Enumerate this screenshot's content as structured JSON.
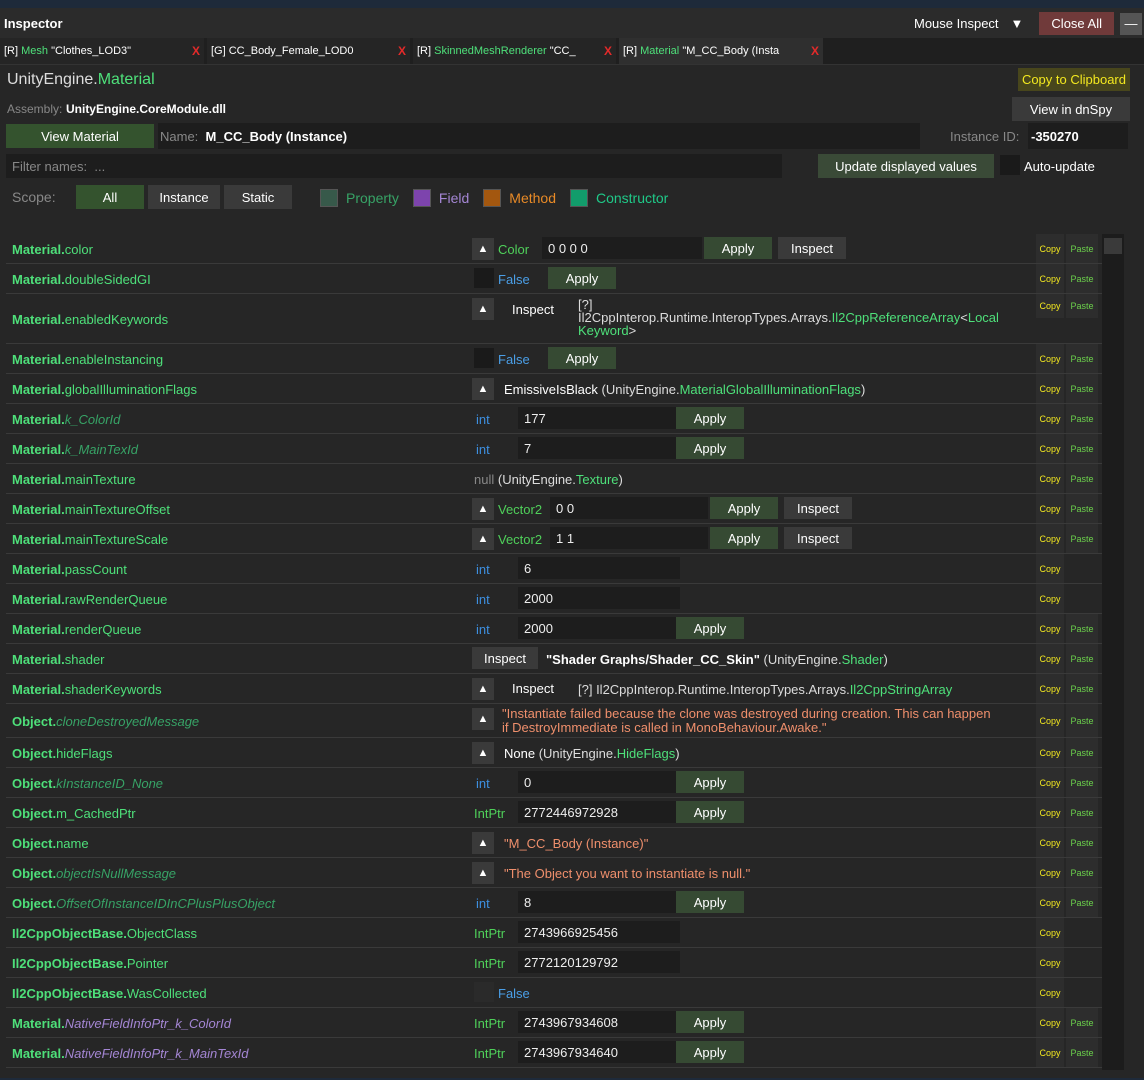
{
  "window": {
    "title": "Inspector",
    "mouse_inspect": "Mouse Inspect",
    "dropdown_glyph": "▼",
    "close_all": "Close All",
    "minimize_glyph": "—"
  },
  "tabs": [
    {
      "prefix": "[R]",
      "kind": "Mesh",
      "name": "\"Clothes_LOD3\"",
      "close": "X"
    },
    {
      "prefix": "[G]",
      "kind": "",
      "name": "CC_Body_Female_LOD0",
      "close": "X"
    },
    {
      "prefix": "[R]",
      "kind": "SkinnedMeshRenderer",
      "name": "\"CC_",
      "close": "X"
    },
    {
      "prefix": "[R]",
      "kind": "Material",
      "name": "\"M_CC_Body (Insta",
      "close": "X"
    }
  ],
  "type_header": {
    "namespace": "UnityEngine.",
    "type": "Material",
    "copy": "Copy to Clipboard"
  },
  "assembly": {
    "label": "Assembly:",
    "value": "UnityEngine.CoreModule.dll",
    "dnspy": "View in dnSpy"
  },
  "material_row": {
    "view_button": "View Material",
    "name_label": "Name:",
    "name_value": "M_CC_Body (Instance)",
    "id_label": "Instance ID:",
    "id_value": "-350270"
  },
  "filter": {
    "label": "Filter names:",
    "placeholder": "...",
    "update_button": "Update displayed values",
    "auto_update": "Auto-update"
  },
  "scope": {
    "label": "Scope:",
    "all": "All",
    "instance": "Instance",
    "static": "Static",
    "legend": {
      "property": "Property",
      "field": "Field",
      "method": "Method",
      "constructor": "Constructor"
    },
    "colors": {
      "property": "#37594a",
      "field": "#7d44ad",
      "method": "#a3570f",
      "constructor": "#129c6b"
    }
  },
  "common": {
    "apply": "Apply",
    "inspect": "Inspect",
    "copy": "Copy",
    "paste": "Paste",
    "up": "▲",
    "int": "int",
    "intptr": "IntPtr"
  },
  "members": [
    {
      "decl": "Material.",
      "member": "color",
      "type_label": "Color",
      "value": "0 0 0 0"
    },
    {
      "decl": "Material.",
      "member": "doubleSidedGI",
      "value": "False"
    },
    {
      "decl": "Material.",
      "member": "enabledKeywords",
      "v1": "[?]",
      "v2": "Il2CppInterop.Runtime.InteropTypes.Arrays.",
      "v3": "Il2CppReferenceArray",
      "v4": "<",
      "v5": "Local",
      "v6": "Keyword",
      "v7": ">"
    },
    {
      "decl": "Material.",
      "member": "enableInstancing",
      "value": "False"
    },
    {
      "decl": "Material.",
      "member": "globalIlluminationFlags",
      "v1": "EmissiveIsBlack",
      "v2": " (UnityEngine.",
      "v3": "MaterialGlobalIlluminationFlags",
      "v4": ")"
    },
    {
      "decl": "Material.",
      "member": "k_ColorId",
      "value": "177"
    },
    {
      "decl": "Material.",
      "member": "k_MainTexId",
      "value": "7"
    },
    {
      "decl": "Material.",
      "member": "mainTexture",
      "v1": "null",
      "v2": " (UnityEngine.",
      "v3": "Texture",
      "v4": ")"
    },
    {
      "decl": "Material.",
      "member": "mainTextureOffset",
      "type_label": "Vector2",
      "value": "0 0"
    },
    {
      "decl": "Material.",
      "member": "mainTextureScale",
      "type_label": "Vector2",
      "value": "1 1"
    },
    {
      "decl": "Material.",
      "member": "passCount",
      "value": "6"
    },
    {
      "decl": "Material.",
      "member": "rawRenderQueue",
      "value": "2000"
    },
    {
      "decl": "Material.",
      "member": "renderQueue",
      "value": "2000"
    },
    {
      "decl": "Material.",
      "member": "shader",
      "v1": "\"Shader Graphs/Shader_CC_Skin\"",
      "v2": " (UnityEngine.",
      "v3": "Shader",
      "v4": ")"
    },
    {
      "decl": "Material.",
      "member": "shaderKeywords",
      "v1": "[?] Il2CppInterop.Runtime.InteropTypes.Arrays.",
      "v2": "Il2CppStringArray"
    },
    {
      "decl": "Object.",
      "member": "cloneDestroyedMessage",
      "l1": "\"Instantiate failed because the clone was destroyed during creation. This can happen",
      "l2": "if DestroyImmediate is called in MonoBehaviour.Awake.\""
    },
    {
      "decl": "Object.",
      "member": "hideFlags",
      "v1": "None",
      "v2": " (UnityEngine.",
      "v3": "HideFlags",
      "v4": ")"
    },
    {
      "decl": "Object.",
      "member": "kInstanceID_None",
      "value": "0"
    },
    {
      "decl": "Object.",
      "member": "m_CachedPtr",
      "value": "2772446972928"
    },
    {
      "decl": "Object.",
      "member": "name",
      "value": "\"M_CC_Body (Instance)\""
    },
    {
      "decl": "Object.",
      "member": "objectIsNullMessage",
      "value": "\"The Object you want to instantiate is null.\""
    },
    {
      "decl": "Object.",
      "member": "OffsetOfInstanceIDInCPlusPlusObject",
      "value": "8"
    },
    {
      "decl": "Il2CppObjectBase.",
      "member": "ObjectClass",
      "value": "2743966925456"
    },
    {
      "decl": "Il2CppObjectBase.",
      "member": "Pointer",
      "value": "2772120129792"
    },
    {
      "decl": "Il2CppObjectBase.",
      "member": "WasCollected",
      "value": "False"
    },
    {
      "decl": "Material.",
      "member": "NativeFieldInfoPtr_k_ColorId",
      "value": "2743967934608"
    },
    {
      "decl": "Material.",
      "member": "NativeFieldInfoPtr_k_MainTexId",
      "value": "2743967934640"
    }
  ]
}
